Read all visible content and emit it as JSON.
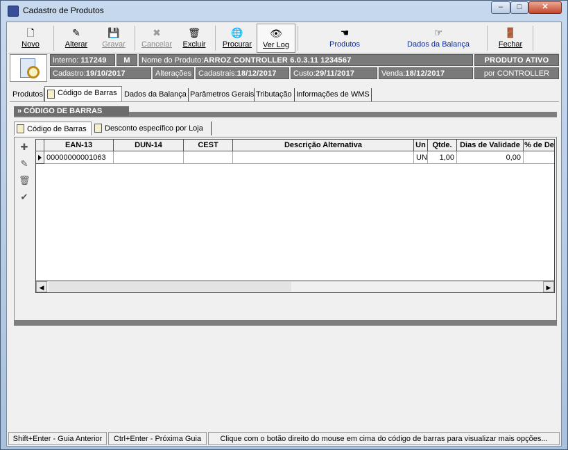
{
  "window": {
    "title": "Cadastro de Produtos",
    "controls": {
      "minimize": "–",
      "maximize": "□",
      "close": "✕"
    }
  },
  "toolbar": {
    "buttons": [
      {
        "label": "Novo",
        "icon": "new-doc-icon",
        "glyph": "🗋",
        "enabled": true
      },
      {
        "label": "Alterar",
        "icon": "edit-icon",
        "glyph": "✎",
        "enabled": true
      },
      {
        "label": "Gravar",
        "icon": "save-icon",
        "glyph": "💾",
        "enabled": false
      },
      {
        "label": "Cancelar",
        "icon": "cancel-icon",
        "glyph": "✖",
        "enabled": false
      },
      {
        "label": "Excluir",
        "icon": "trash-icon",
        "glyph": "🗑",
        "enabled": true
      },
      {
        "label": "Procurar",
        "icon": "globe-search-icon",
        "glyph": "🌐",
        "enabled": true
      },
      {
        "label": "Ver Log",
        "icon": "eye-icon",
        "glyph": "👁",
        "enabled": true
      },
      {
        "label": "Produtos",
        "icon": "hand-pointer-icon",
        "glyph": "☚",
        "enabled": true
      },
      {
        "label": "Dados da Balança",
        "icon": "hand-pointer-icon",
        "glyph": "☞",
        "enabled": true
      },
      {
        "label": "Fechar",
        "icon": "exit-door-icon",
        "glyph": "🚪",
        "enabled": true
      }
    ]
  },
  "product": {
    "interno_label": "Interno:",
    "interno_value": "117249",
    "m_flag": "M",
    "nome_label": "Nome do Produto:",
    "nome_value": "ARROZ CONTROLLER 6.0.3.11 1234567",
    "status": "PRODUTO ATIVO",
    "cadastro_label": "Cadastro:",
    "cadastro_value": "19/10/2017",
    "alteracoes_label": "Alterações",
    "cadastrais_label": "Cadastrais:",
    "cadastrais_value": "18/12/2017",
    "custo_label": "Custo:",
    "custo_value": "29/11/2017",
    "venda_label": "Venda:",
    "venda_value": "18/12/2017",
    "por_label": "por CONTROLLER"
  },
  "tabs": [
    {
      "label": "Produtos",
      "active": false
    },
    {
      "label": "Código de Barras",
      "active": true
    },
    {
      "label": "Dados da Balança",
      "active": false
    },
    {
      "label": "Parâmetros Gerais",
      "active": false
    },
    {
      "label": "Tributação",
      "active": false
    },
    {
      "label": "Informações de WMS",
      "active": false
    }
  ],
  "section": {
    "title": "» CÓDIGO DE BARRAS"
  },
  "subtabs": [
    {
      "label": "Código de Barras",
      "active": true
    },
    {
      "label": "Desconto específico por Loja",
      "active": false
    }
  ],
  "grid": {
    "columns": [
      "EAN-13",
      "DUN-14",
      "CEST",
      "Descrição Alternativa",
      "Un",
      "Qtde.",
      "Dias de Validade",
      "% de De"
    ],
    "rows": [
      [
        "00000000001063",
        "",
        "",
        "",
        "UN",
        "1,00",
        "0,00",
        ""
      ]
    ]
  },
  "statusbar": {
    "prev": "Shift+Enter - Guia Anterior",
    "next": "Ctrl+Enter - Próxima Guia",
    "hint": "Clique com o botão direito do mouse em cima do código de barras para visualizar mais opções..."
  }
}
